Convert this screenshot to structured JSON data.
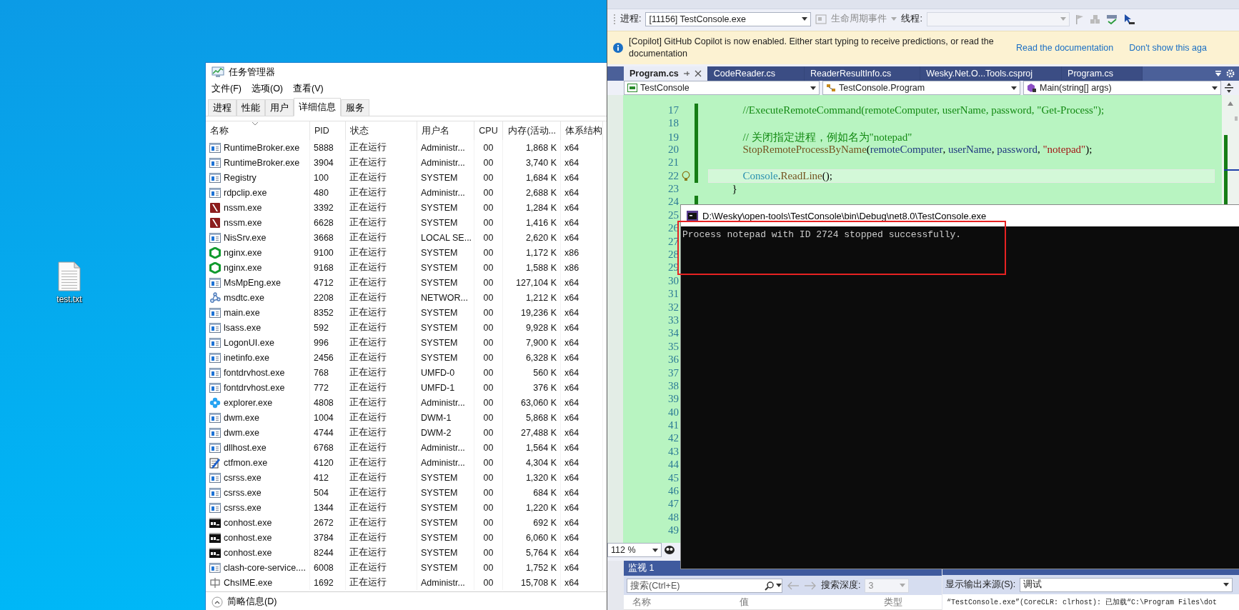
{
  "desktop": {
    "icons": [
      {
        "label": "test.txt"
      }
    ]
  },
  "task_manager": {
    "title": "任务管理器",
    "menu": [
      "文件(F)",
      "选项(O)",
      "查看(V)"
    ],
    "tabs": [
      {
        "label": "进程",
        "selected": false
      },
      {
        "label": "性能",
        "selected": false
      },
      {
        "label": "用户",
        "selected": false
      },
      {
        "label": "详细信息",
        "selected": true
      },
      {
        "label": "服务",
        "selected": false
      }
    ],
    "columns": [
      "名称",
      "PID",
      "状态",
      "用户名",
      "CPU",
      "内存(活动...",
      "体系结构"
    ],
    "rows": [
      {
        "kind": "app",
        "name": "RuntimeBroker.exe",
        "pid": "5888",
        "status": "正在运行",
        "user": "Administr...",
        "cpu": "00",
        "memory": "1,868 K",
        "arch": "x64"
      },
      {
        "kind": "app",
        "name": "RuntimeBroker.exe",
        "pid": "3904",
        "status": "正在运行",
        "user": "Administr...",
        "cpu": "00",
        "memory": "3,740 K",
        "arch": "x64"
      },
      {
        "kind": "app",
        "name": "Registry",
        "pid": "100",
        "status": "正在运行",
        "user": "SYSTEM",
        "cpu": "00",
        "memory": "1,684 K",
        "arch": "x64"
      },
      {
        "kind": "app",
        "name": "rdpclip.exe",
        "pid": "480",
        "status": "正在运行",
        "user": "Administr...",
        "cpu": "00",
        "memory": "2,688 K",
        "arch": "x64"
      },
      {
        "kind": "nssm",
        "name": "nssm.exe",
        "pid": "3392",
        "status": "正在运行",
        "user": "SYSTEM",
        "cpu": "00",
        "memory": "1,284 K",
        "arch": "x64"
      },
      {
        "kind": "nssm",
        "name": "nssm.exe",
        "pid": "6628",
        "status": "正在运行",
        "user": "SYSTEM",
        "cpu": "00",
        "memory": "1,416 K",
        "arch": "x64"
      },
      {
        "kind": "app",
        "name": "NisSrv.exe",
        "pid": "3668",
        "status": "正在运行",
        "user": "LOCAL SE...",
        "cpu": "00",
        "memory": "2,620 K",
        "arch": "x64"
      },
      {
        "kind": "nginx",
        "name": "nginx.exe",
        "pid": "9100",
        "status": "正在运行",
        "user": "SYSTEM",
        "cpu": "00",
        "memory": "1,172 K",
        "arch": "x86"
      },
      {
        "kind": "nginx",
        "name": "nginx.exe",
        "pid": "9168",
        "status": "正在运行",
        "user": "SYSTEM",
        "cpu": "00",
        "memory": "1,588 K",
        "arch": "x86"
      },
      {
        "kind": "app",
        "name": "MsMpEng.exe",
        "pid": "4712",
        "status": "正在运行",
        "user": "SYSTEM",
        "cpu": "00",
        "memory": "127,104 K",
        "arch": "x64"
      },
      {
        "kind": "msdtc",
        "name": "msdtc.exe",
        "pid": "2208",
        "status": "正在运行",
        "user": "NETWOR...",
        "cpu": "00",
        "memory": "1,212 K",
        "arch": "x64"
      },
      {
        "kind": "app",
        "name": "main.exe",
        "pid": "8352",
        "status": "正在运行",
        "user": "SYSTEM",
        "cpu": "00",
        "memory": "19,236 K",
        "arch": "x64"
      },
      {
        "kind": "app",
        "name": "lsass.exe",
        "pid": "592",
        "status": "正在运行",
        "user": "SYSTEM",
        "cpu": "00",
        "memory": "9,928 K",
        "arch": "x64"
      },
      {
        "kind": "app",
        "name": "LogonUI.exe",
        "pid": "996",
        "status": "正在运行",
        "user": "SYSTEM",
        "cpu": "00",
        "memory": "7,900 K",
        "arch": "x64"
      },
      {
        "kind": "app",
        "name": "inetinfo.exe",
        "pid": "2456",
        "status": "正在运行",
        "user": "SYSTEM",
        "cpu": "00",
        "memory": "6,328 K",
        "arch": "x64"
      },
      {
        "kind": "app",
        "name": "fontdrvhost.exe",
        "pid": "768",
        "status": "正在运行",
        "user": "UMFD-0",
        "cpu": "00",
        "memory": "560 K",
        "arch": "x64"
      },
      {
        "kind": "app",
        "name": "fontdrvhost.exe",
        "pid": "772",
        "status": "正在运行",
        "user": "UMFD-1",
        "cpu": "00",
        "memory": "376 K",
        "arch": "x64"
      },
      {
        "kind": "explorer",
        "name": "explorer.exe",
        "pid": "4808",
        "status": "正在运行",
        "user": "Administr...",
        "cpu": "00",
        "memory": "63,060 K",
        "arch": "x64"
      },
      {
        "kind": "app",
        "name": "dwm.exe",
        "pid": "1004",
        "status": "正在运行",
        "user": "DWM-1",
        "cpu": "00",
        "memory": "5,868 K",
        "arch": "x64"
      },
      {
        "kind": "app",
        "name": "dwm.exe",
        "pid": "4744",
        "status": "正在运行",
        "user": "DWM-2",
        "cpu": "00",
        "memory": "27,488 K",
        "arch": "x64"
      },
      {
        "kind": "app",
        "name": "dllhost.exe",
        "pid": "6768",
        "status": "正在运行",
        "user": "Administr...",
        "cpu": "00",
        "memory": "1,564 K",
        "arch": "x64"
      },
      {
        "kind": "ctfmon",
        "name": "ctfmon.exe",
        "pid": "4120",
        "status": "正在运行",
        "user": "Administr...",
        "cpu": "00",
        "memory": "4,304 K",
        "arch": "x64"
      },
      {
        "kind": "app",
        "name": "csrss.exe",
        "pid": "412",
        "status": "正在运行",
        "user": "SYSTEM",
        "cpu": "00",
        "memory": "1,320 K",
        "arch": "x64"
      },
      {
        "kind": "app",
        "name": "csrss.exe",
        "pid": "504",
        "status": "正在运行",
        "user": "SYSTEM",
        "cpu": "00",
        "memory": "684 K",
        "arch": "x64"
      },
      {
        "kind": "app",
        "name": "csrss.exe",
        "pid": "1344",
        "status": "正在运行",
        "user": "SYSTEM",
        "cpu": "00",
        "memory": "1,220 K",
        "arch": "x64"
      },
      {
        "kind": "console",
        "name": "conhost.exe",
        "pid": "2672",
        "status": "正在运行",
        "user": "SYSTEM",
        "cpu": "00",
        "memory": "692 K",
        "arch": "x64"
      },
      {
        "kind": "console",
        "name": "conhost.exe",
        "pid": "3784",
        "status": "正在运行",
        "user": "SYSTEM",
        "cpu": "00",
        "memory": "6,060 K",
        "arch": "x64"
      },
      {
        "kind": "console",
        "name": "conhost.exe",
        "pid": "8244",
        "status": "正在运行",
        "user": "SYSTEM",
        "cpu": "00",
        "memory": "5,764 K",
        "arch": "x64"
      },
      {
        "kind": "app",
        "name": "clash-core-service....",
        "pid": "6008",
        "status": "正在运行",
        "user": "SYSTEM",
        "cpu": "00",
        "memory": "1,752 K",
        "arch": "x64"
      },
      {
        "kind": "ime",
        "name": "ChsIME.exe",
        "pid": "1692",
        "status": "正在运行",
        "user": "Administr...",
        "cpu": "00",
        "memory": "15,708 K",
        "arch": "x64"
      }
    ],
    "footer": "简略信息(D)"
  },
  "visual_studio": {
    "debug_toolbar": {
      "process_label": "进程:",
      "process": "[11156] TestConsole.exe",
      "lifecycle": {
        "label": "生命周期事件",
        "disabled": true
      },
      "thread_label": "线程:"
    },
    "info_bar": {
      "message": "[Copilot] GitHub Copilot is now enabled. Either start typing to receive predictions, or read the documentation",
      "links": [
        "Read the documentation",
        "Don't show this aga"
      ]
    },
    "tabs": [
      {
        "label": "Program.cs",
        "selected": true
      },
      {
        "label": "CodeReader.cs",
        "selected": false
      },
      {
        "label": "ReaderResultInfo.cs",
        "selected": false
      },
      {
        "label": "Wesky.Net.O...Tools.csproj",
        "selected": false
      },
      {
        "label": "Program.cs",
        "selected": false
      }
    ],
    "nav": [
      "TestConsole",
      "TestConsole.Program",
      "Main(string[] args)"
    ],
    "editor": {
      "lines": [
        {
          "number": "17",
          "changed": true,
          "current": false,
          "tokens": [
            {
              "kind": "comment",
              "text": "          //ExecuteRemoteCommand(remoteComputer, userName, password, \"Get-Process\");"
            }
          ]
        },
        {
          "number": "18",
          "changed": true,
          "current": false
        },
        {
          "number": "19",
          "changed": true,
          "current": false,
          "tokens": [
            {
              "kind": "comment",
              "text": "          // 关闭指定进程，例如名为\"notepad\""
            }
          ]
        },
        {
          "number": "20",
          "changed": true,
          "current": false,
          "tokens": [
            {
              "kind": "method",
              "text": "          StopRemoteProcessByName"
            },
            {
              "kind": "plain",
              "text": "("
            },
            {
              "kind": "param",
              "text": "remoteComputer"
            },
            {
              "kind": "plain",
              "text": ", "
            },
            {
              "kind": "param",
              "text": "userName"
            },
            {
              "kind": "plain",
              "text": ", "
            },
            {
              "kind": "param",
              "text": "password"
            },
            {
              "kind": "plain",
              "text": ", "
            },
            {
              "kind": "string",
              "text": "\"notepad\""
            },
            {
              "kind": "plain",
              "text": ");"
            }
          ]
        },
        {
          "number": "21",
          "changed": true,
          "current": false
        },
        {
          "number": "22",
          "changed": true,
          "current": true,
          "tokens": [
            {
              "kind": "type",
              "text": "          Console"
            },
            {
              "kind": "plain",
              "text": "."
            },
            {
              "kind": "method",
              "text": "ReadLine"
            },
            {
              "kind": "plain",
              "text": "();"
            }
          ]
        },
        {
          "number": "23",
          "changed": false,
          "current": false,
          "tokens": [
            {
              "kind": "plain",
              "text": "      }"
            }
          ]
        },
        {
          "number": "24",
          "changed": true,
          "current": false
        },
        {
          "number": "25"
        },
        {
          "number": "26"
        },
        {
          "number": "27"
        },
        {
          "number": "28"
        },
        {
          "number": "29"
        },
        {
          "number": "30"
        },
        {
          "number": "31"
        },
        {
          "number": "32"
        },
        {
          "number": "33"
        },
        {
          "number": "34"
        },
        {
          "number": "35"
        },
        {
          "number": "36"
        },
        {
          "number": "37"
        },
        {
          "number": "38"
        },
        {
          "number": "39"
        },
        {
          "number": "40"
        },
        {
          "number": "41"
        },
        {
          "number": "42"
        },
        {
          "number": "43"
        },
        {
          "number": "44"
        },
        {
          "number": "45"
        },
        {
          "number": "46"
        },
        {
          "number": "47"
        },
        {
          "number": "48"
        },
        {
          "number": "49"
        }
      ]
    },
    "zoom": "112 %",
    "watch": {
      "title": "监视 1",
      "search_placeholder": "搜索(Ctrl+E)",
      "depth_label": "搜索深度:",
      "depth": "3",
      "columns": [
        "名称",
        "值",
        "类型"
      ]
    },
    "output": {
      "source_label": "显示输出来源(S):",
      "source": "调试",
      "lines": [
        "“TestConsole.exe”(CoreCLR: clrhost): 已加载“C:\\Program Files\\dot"
      ]
    }
  },
  "console": {
    "title": "D:\\Wesky\\open-tools\\TestConsole\\bin\\Debug\\net8.0\\TestConsole.exe",
    "output": [
      "Process notepad with ID 2724 stopped successfully."
    ]
  }
}
